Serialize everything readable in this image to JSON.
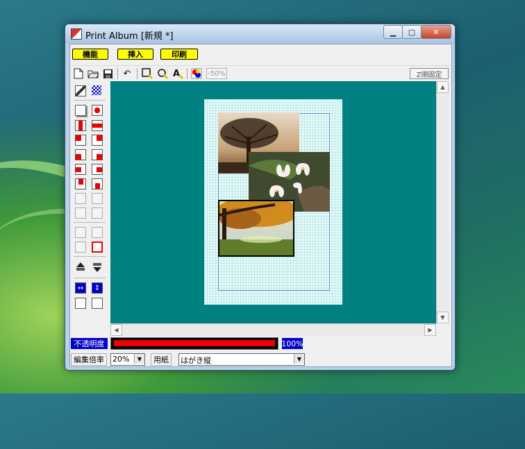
{
  "window": {
    "title": "Print Album [新規 *]",
    "controls": {
      "minimize": "▁",
      "maximize": "▢",
      "close": "✕"
    }
  },
  "menu": [
    {
      "label": "機能"
    },
    {
      "label": "挿入"
    },
    {
      "label": "印刷"
    }
  ],
  "toolbar": {
    "icons": [
      "new-file-icon",
      "open-folder-icon",
      "save-icon",
      "undo-icon",
      "frame-select-icon",
      "rotate-icon",
      "text-icon",
      "color-icon"
    ],
    "zoom_step": "-50%",
    "fix_button": "Z順固定"
  },
  "opacity": {
    "label": "不透明度",
    "value_text": "100%",
    "value": 1.0
  },
  "status": {
    "zoom_label": "編集倍率",
    "zoom_value": "20%",
    "paper_label": "用紙",
    "paper_value": "はがき縦"
  },
  "colors": {
    "canvas": "#008080",
    "menu_button": "#ffff00",
    "opacity_label_bg": "#0000cc",
    "opacity_fill": "#ee0000"
  }
}
